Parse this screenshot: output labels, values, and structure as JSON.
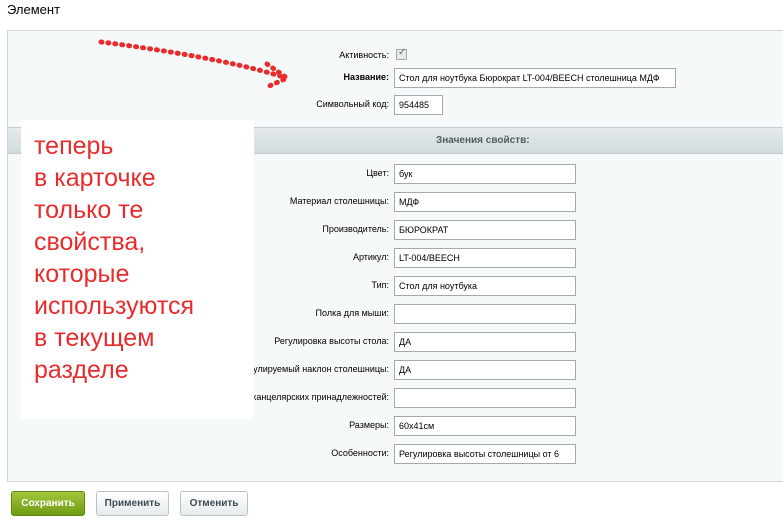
{
  "page": {
    "title": "Элемент"
  },
  "main_fields": {
    "active_label": "Активность:",
    "active_checked": true,
    "name_label": "Название:",
    "name_value": "Стол для ноутбука Бюрократ LT-004/BEECH столешница МДФ",
    "code_label": "Символьный код:",
    "code_value": "954485"
  },
  "properties": {
    "heading": "Значения свойств:",
    "items": [
      {
        "label": "Цвет:",
        "value": "бук"
      },
      {
        "label": "Материал столешницы:",
        "value": "МДФ"
      },
      {
        "label": "Производитель:",
        "value": "БЮРОКРАТ"
      },
      {
        "label": "Артикул:",
        "value": "LT-004/BEECH"
      },
      {
        "label": "Тип:",
        "value": "Стол для ноутбука"
      },
      {
        "label": "Полка для мыши:",
        "value": ""
      },
      {
        "label": "Регулировка высоты стола:",
        "value": "ДА"
      },
      {
        "label": "Регулируемый наклон столешницы:",
        "value": "ДА"
      },
      {
        "label": "Углубления для канцелярских принадлежностей:",
        "value": ""
      },
      {
        "label": "Размеры:",
        "value": "60x41см"
      },
      {
        "label": "Особенности:",
        "value": "Регулировка высоты столешницы от 6"
      }
    ]
  },
  "annotation": {
    "text": "теперь\nв карточке\nтолько те\nсвойства,\nкоторые\nиспользуются\nв текущем\nразделе",
    "color": "#e82c2c"
  },
  "buttons": {
    "save": "Сохранить",
    "apply": "Применить",
    "cancel": "Отменить"
  }
}
